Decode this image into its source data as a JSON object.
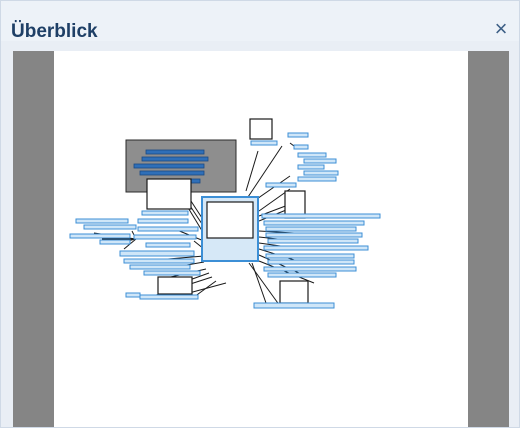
{
  "window": {
    "title": "Überblick",
    "close_glyph": "×",
    "close_icon": "close-icon"
  },
  "colors": {
    "title_text": "#1e3f66",
    "gutter": "#858585",
    "topic_fill": "#cfe6f8",
    "topic_stroke": "#3c8fd6",
    "viewport_fill": "#8e8e8e"
  }
}
